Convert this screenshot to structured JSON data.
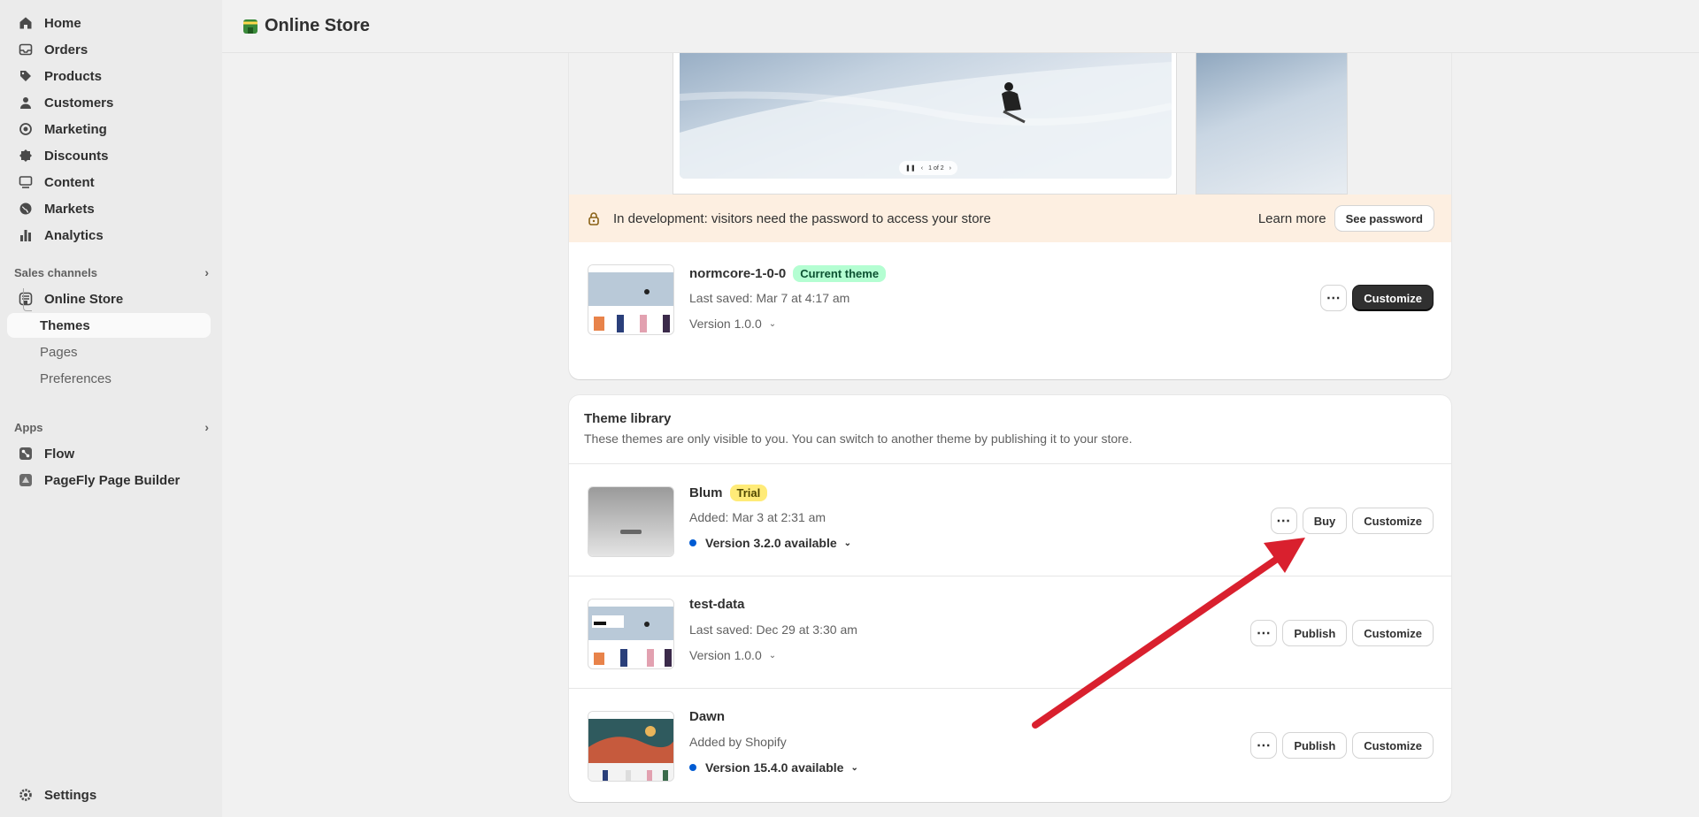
{
  "sidebar": {
    "items": [
      {
        "label": "Home",
        "icon": "home-icon"
      },
      {
        "label": "Orders",
        "icon": "inbox-icon"
      },
      {
        "label": "Products",
        "icon": "tag-icon"
      },
      {
        "label": "Customers",
        "icon": "person-icon"
      },
      {
        "label": "Marketing",
        "icon": "target-icon"
      },
      {
        "label": "Discounts",
        "icon": "discount-icon"
      },
      {
        "label": "Content",
        "icon": "content-icon"
      },
      {
        "label": "Markets",
        "icon": "globe-icon"
      },
      {
        "label": "Analytics",
        "icon": "chart-icon"
      }
    ],
    "sales_channels_label": "Sales channels",
    "online_store_label": "Online Store",
    "sub_items": [
      "Themes",
      "Pages",
      "Preferences"
    ],
    "apps_label": "Apps",
    "apps": [
      "Flow",
      "PageFly Page Builder"
    ],
    "settings_label": "Settings"
  },
  "header": {
    "title": "Online Store"
  },
  "preview": {
    "pager": "1 of 2"
  },
  "banner": {
    "message": "In development: visitors need the password to access your store",
    "learn_more": "Learn more",
    "see_password": "See password"
  },
  "current_theme": {
    "name": "normcore-1-0-0",
    "badge": "Current theme",
    "saved": "Last saved: Mar 7 at 4:17 am",
    "version": "Version 1.0.0",
    "customize": "Customize"
  },
  "library": {
    "title": "Theme library",
    "description": "These themes are only visible to you. You can switch to another theme by publishing it to your store.",
    "themes": [
      {
        "name": "Blum",
        "badge": "Trial",
        "meta": "Added: Mar 3 at 2:31 am",
        "version": "Version 3.2.0 available",
        "action": "Buy",
        "customize": "Customize"
      },
      {
        "name": "test-data",
        "meta": "Last saved: Dec 29 at 3:30 am",
        "version": "Version 1.0.0",
        "action": "Publish",
        "customize": "Customize"
      },
      {
        "name": "Dawn",
        "meta": "Added by Shopify",
        "version": "Version 15.4.0 available",
        "action": "Publish",
        "customize": "Customize"
      }
    ]
  },
  "colors": {
    "accent_dark": "#303030",
    "arrow": "#d9202e",
    "banner_bg": "#fdefe1",
    "update_dot": "#005bd3"
  }
}
